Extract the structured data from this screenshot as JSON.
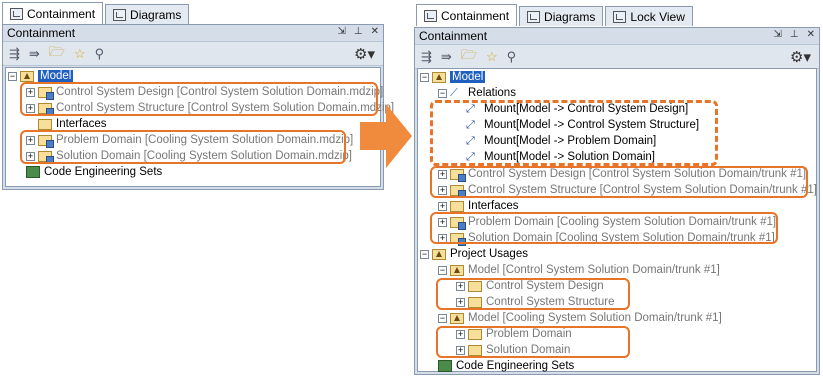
{
  "left": {
    "tabs": [
      "Containment",
      "Diagrams"
    ],
    "panel_title": "Containment",
    "rows": [
      {
        "text": "Model",
        "sel": true
      },
      {
        "text": "Control System Design [Control System Solution Domain.mdzip]"
      },
      {
        "text": "Control System Structure [Control System Solution Domain.mdzip]"
      },
      {
        "text": "Interfaces"
      },
      {
        "text": "Problem Domain [Cooling System Solution Domain.mdzip]"
      },
      {
        "text": "Solution Domain [Cooling System Solution Domain.mdzip]"
      },
      {
        "text": "Code Engineering Sets"
      }
    ]
  },
  "right": {
    "tabs": [
      "Containment",
      "Diagrams",
      "Lock View"
    ],
    "panel_title": "Containment",
    "rows": [
      {
        "text": "Model"
      },
      {
        "text": "Relations"
      },
      {
        "text": "Mount[Model -> Control System Design]"
      },
      {
        "text": "Mount[Model -> Control System Structure]"
      },
      {
        "text": "Mount[Model -> Problem Domain]"
      },
      {
        "text": "Mount[Model -> Solution Domain]"
      },
      {
        "text": "Control System Design [Control System Solution Domain/trunk #1]"
      },
      {
        "text": "Control System Structure [Control System Solution Domain/trunk #1]"
      },
      {
        "text": "Interfaces"
      },
      {
        "text": "Problem Domain [Cooling System Solution Domain/trunk #1]"
      },
      {
        "text": "Solution Domain [Cooling System Solution Domain/trunk #1]"
      },
      {
        "text": "Project Usages"
      },
      {
        "text": "Model [Control System Solution Domain/trunk #1]"
      },
      {
        "text": "Control System Design"
      },
      {
        "text": "Control System Structure"
      },
      {
        "text": "Model [Cooling System Solution Domain/trunk #1]"
      },
      {
        "text": "Problem Domain"
      },
      {
        "text": "Solution Domain"
      },
      {
        "text": "Code Engineering Sets"
      }
    ]
  },
  "colors": {
    "highlight": "#e8742a",
    "selection": "#1f5fbf",
    "panel": "#d4dde8"
  }
}
